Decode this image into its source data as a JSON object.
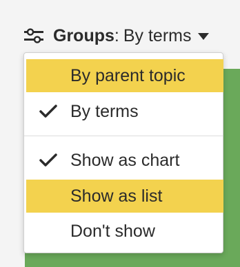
{
  "header": {
    "groups_label": "Groups",
    "colon": ":",
    "current_value": "By terms",
    "icon": "sliders-icon",
    "caret_icon": "caret-down-icon"
  },
  "menu": {
    "group_by": [
      {
        "label": "By parent topic",
        "checked": false,
        "highlighted": true
      },
      {
        "label": "By terms",
        "checked": true,
        "highlighted": false
      }
    ],
    "display": [
      {
        "label": "Show as chart",
        "checked": true,
        "highlighted": false
      },
      {
        "label": "Show as list",
        "checked": false,
        "highlighted": true
      },
      {
        "label": "Don't show",
        "checked": false,
        "highlighted": false
      }
    ]
  },
  "colors": {
    "highlight": "#f3d24e",
    "background_panel": "#6aa95a",
    "text": "#2b2b2b"
  }
}
